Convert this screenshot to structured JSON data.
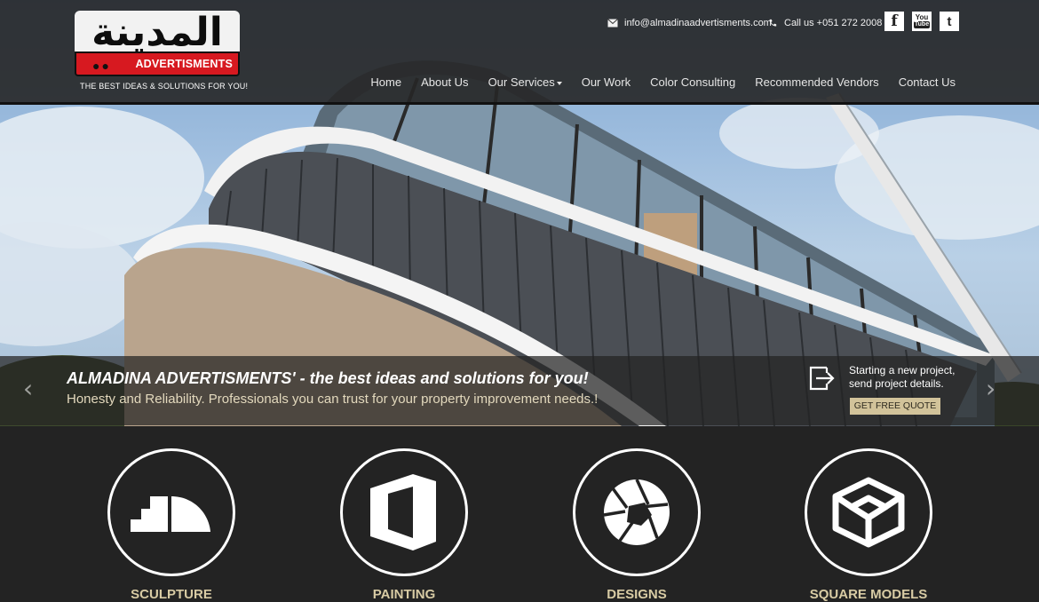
{
  "brand": {
    "arabic_name": "المدينة",
    "name": "ADVERTISMENTS",
    "tagline": "THE BEST IDEAS & SOLUTIONS FOR YOU!"
  },
  "contact": {
    "email": "info@almadinaadvertisments.com",
    "phone": "Call us +051 272 2008"
  },
  "social": {
    "facebook": "f",
    "youtube_top": "You",
    "youtube_bottom": "Tube",
    "twitter": "t"
  },
  "nav": {
    "items": [
      "Home",
      "About Us",
      "Our Services",
      "Our Work",
      "Color Consulting",
      "Recommended Vendors",
      "Contact Us"
    ]
  },
  "slider": {
    "title": "ALMADINA ADVERTISMENTS' - the best ideas and solutions for you!",
    "subtitle": "Honesty and Reliability. Professionals you can trust for your property improvement needs.!",
    "project_line1": "Starting a new project,",
    "project_line2": "send project details.",
    "quote_button": "GET FREE QUOTE",
    "prev": "‹",
    "next": "›"
  },
  "services": [
    {
      "label": "SCULPTURE",
      "icon": "sculpture-icon"
    },
    {
      "label": "PAINTING",
      "icon": "office-icon"
    },
    {
      "label": "DESIGNS",
      "icon": "aperture-icon"
    },
    {
      "label": "SQUARE MODELS",
      "icon": "cube-icon"
    }
  ],
  "colors": {
    "accent": "#d2c39a",
    "logo_red": "#d71920",
    "header_bg": "#262626"
  }
}
